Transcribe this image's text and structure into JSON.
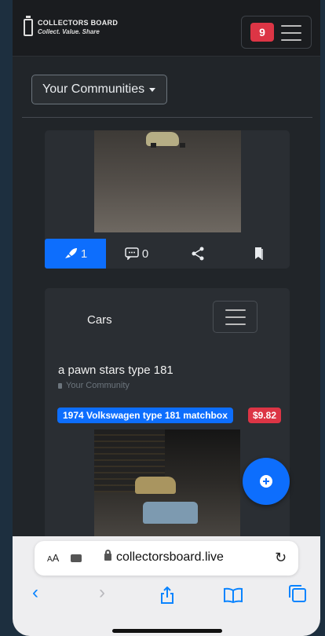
{
  "navbar": {
    "brand_title": "COLLECTORS BOARD",
    "brand_subtitle": "Collect. Value. Share",
    "notification_count": "9"
  },
  "community_button": {
    "label": "Your Communities"
  },
  "post1": {
    "actions": [
      {
        "icon": "rocket-icon",
        "count": "1",
        "active": true
      },
      {
        "icon": "comment-icon",
        "count": "0"
      },
      {
        "icon": "share-icon"
      },
      {
        "icon": "bookmark-icon"
      }
    ]
  },
  "post2": {
    "community": "Cars",
    "title": "a pawn stars type 181",
    "subtitle": "Your Community",
    "item_tag": "1974 Volkswagen type 181 matchbox",
    "price": "$9.82"
  },
  "browser": {
    "aa_label": "AA",
    "url": "collectorsboard.live",
    "back": "‹",
    "forward": "›"
  },
  "colors": {
    "primary": "#0d6efd",
    "danger": "#dc3545",
    "background": "#212529"
  }
}
